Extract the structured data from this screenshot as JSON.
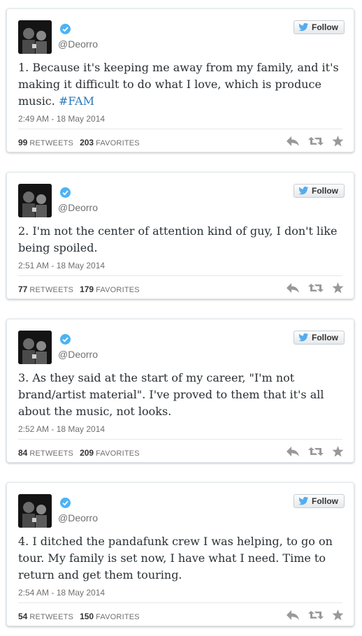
{
  "colors": {
    "accent": "#2b7bb9",
    "verified": "#4cb3f5",
    "icon": "#999999"
  },
  "tweets": [
    {
      "handle": "@Deorro",
      "follow_label": "Follow",
      "text": "1. Because it's keeping me away from my family, and it's making it difficult to do what I love, which is produce music. ",
      "hashtag": "#FAM",
      "timestamp": "2:49 AM - 18 May 2014",
      "retweets": "99",
      "retweets_label": "RETWEETS",
      "favorites": "203",
      "favorites_label": "FAVORITES"
    },
    {
      "handle": "@Deorro",
      "follow_label": "Follow",
      "text": "2. I'm not the center of attention kind of guy, I don't like being spoiled.",
      "hashtag": "",
      "timestamp": "2:51 AM - 18 May 2014",
      "retweets": "77",
      "retweets_label": "RETWEETS",
      "favorites": "179",
      "favorites_label": "FAVORITES"
    },
    {
      "handle": "@Deorro",
      "follow_label": "Follow",
      "text": "3. As they said at the start of my career, \"I'm not brand/artist material\". I've proved to them that it's all about the music, not looks.",
      "hashtag": "",
      "timestamp": "2:52 AM - 18 May 2014",
      "retweets": "84",
      "retweets_label": "RETWEETS",
      "favorites": "209",
      "favorites_label": "FAVORITES"
    },
    {
      "handle": "@Deorro",
      "follow_label": "Follow",
      "text": "4. I ditched the pandafunk crew I was helping, to go on tour. My family is set now, I have what I need. Time to return and get them touring.",
      "hashtag": "",
      "timestamp": "2:54 AM - 18 May 2014",
      "retweets": "54",
      "retweets_label": "RETWEETS",
      "favorites": "150",
      "favorites_label": "FAVORITES"
    }
  ]
}
